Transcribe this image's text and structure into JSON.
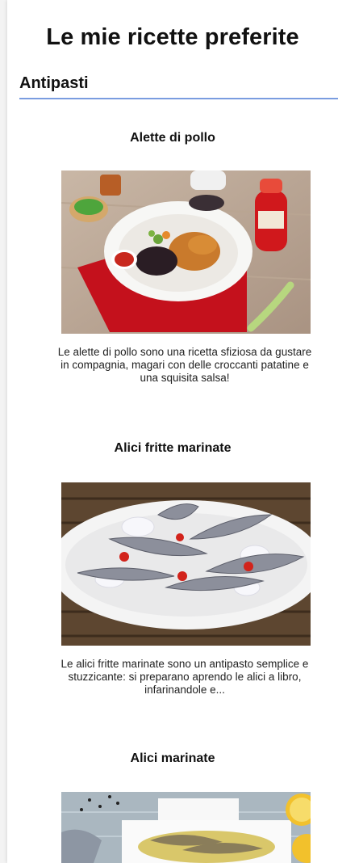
{
  "page": {
    "title": "Le mie ricette preferite"
  },
  "section": {
    "title": "Antipasti"
  },
  "recipes": [
    {
      "title": "Alette di pollo",
      "description": "Le alette di pollo sono una ricetta sfiziosa da gustare in compagnia, magari con delle croccanti patatine e una squisita salsa!"
    },
    {
      "title": "Alici fritte marinate",
      "description": "Le alici fritte marinate sono un antipasto semplice e stuzzicante: si preparano aprendo le alici a libro, infarinandole e..."
    },
    {
      "title": "Alici marinate",
      "description": ""
    }
  ]
}
